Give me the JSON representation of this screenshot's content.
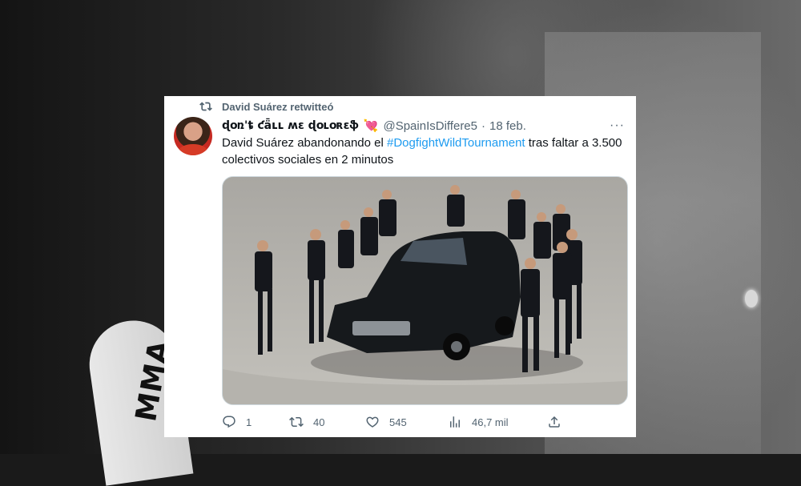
{
  "retweet": {
    "label": "David Suárez retwitteó"
  },
  "author": {
    "display_name": "ɖօռ'ȶ ƈǟʟʟ ʍɛ ɖօʟօʀɛֆ",
    "emoji": "💘",
    "handle": "@SpainIsDiffere5",
    "separator": "·",
    "date": "18 feb."
  },
  "more_label": "···",
  "tweet": {
    "text_before": "David Suárez abandonando el ",
    "hashtag": "#DogfightWildTournament",
    "text_after": " tras faltar a 3.500 colectivos sociales en 2 minutos"
  },
  "metrics": {
    "replies": "1",
    "retweets": "40",
    "likes": "545",
    "views": "46,7 mil"
  },
  "background": {
    "sleeve_text": "MMA"
  },
  "colors": {
    "accent": "#1d9bf0",
    "secondary_text": "#536471",
    "primary_text": "#0f1419"
  },
  "icons": [
    "retweet-icon",
    "more-icon",
    "reply-icon",
    "retweet-icon",
    "like-icon",
    "views-icon",
    "share-icon"
  ]
}
